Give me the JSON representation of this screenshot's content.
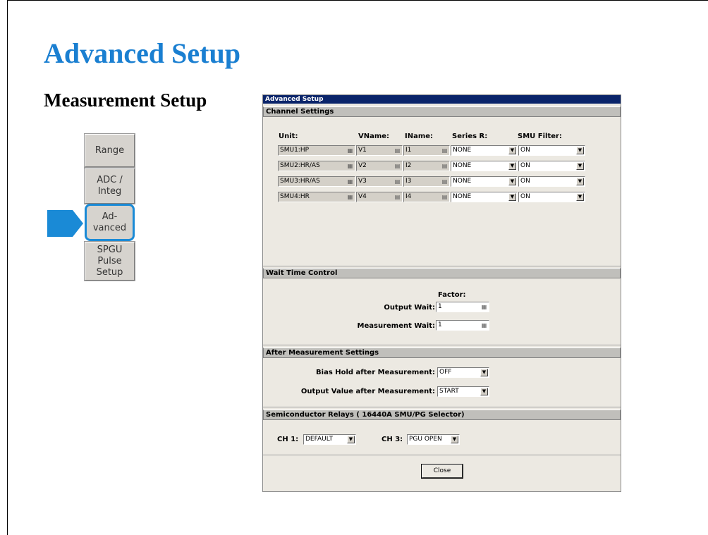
{
  "slide": {
    "title": "Advanced Setup",
    "subtitle": "Measurement Setup"
  },
  "sidebar": {
    "buttons": [
      {
        "label": "Range"
      },
      {
        "label": "ADC /\nInteg"
      },
      {
        "label": "Ad-\nvanced",
        "active": true
      },
      {
        "label": "SPGU\nPulse\nSetup"
      }
    ]
  },
  "dialog": {
    "title": "Advanced Setup",
    "channel_settings": {
      "header": "Channel Settings",
      "columns": [
        "Unit:",
        "VName:",
        "IName:",
        "Series R:",
        "SMU Filter:"
      ],
      "rows": [
        {
          "unit": "SMU1:HP",
          "vname": "V1",
          "iname": "I1",
          "series_r": "NONE",
          "filter": "ON"
        },
        {
          "unit": "SMU2:HR/AS",
          "vname": "V2",
          "iname": "I2",
          "series_r": "NONE",
          "filter": "ON"
        },
        {
          "unit": "SMU3:HR/AS",
          "vname": "V3",
          "iname": "I3",
          "series_r": "NONE",
          "filter": "ON"
        },
        {
          "unit": "SMU4:HR",
          "vname": "V4",
          "iname": "I4",
          "series_r": "NONE",
          "filter": "ON"
        }
      ]
    },
    "wait_time": {
      "header": "Wait Time Control",
      "factor_label": "Factor:",
      "output_wait_label": "Output Wait:",
      "output_wait_value": "1",
      "measurement_wait_label": "Measurement Wait:",
      "measurement_wait_value": "1"
    },
    "after_measurement": {
      "header": "After Measurement Settings",
      "bias_hold_label": "Bias Hold after Measurement:",
      "bias_hold_value": "OFF",
      "output_value_label": "Output Value after Measurement:",
      "output_value_value": "START"
    },
    "relays": {
      "header": "Semiconductor Relays ( 16440A SMU/PG Selector)",
      "ch1_label": "CH 1:",
      "ch1_value": "DEFAULT",
      "ch3_label": "CH 3:",
      "ch3_value": "PGU OPEN"
    },
    "close_label": "Close"
  },
  "colors": {
    "title_blue": "#1a7fd1",
    "arrow_blue": "#1a8ad6",
    "titlebar": "#0a246a"
  }
}
